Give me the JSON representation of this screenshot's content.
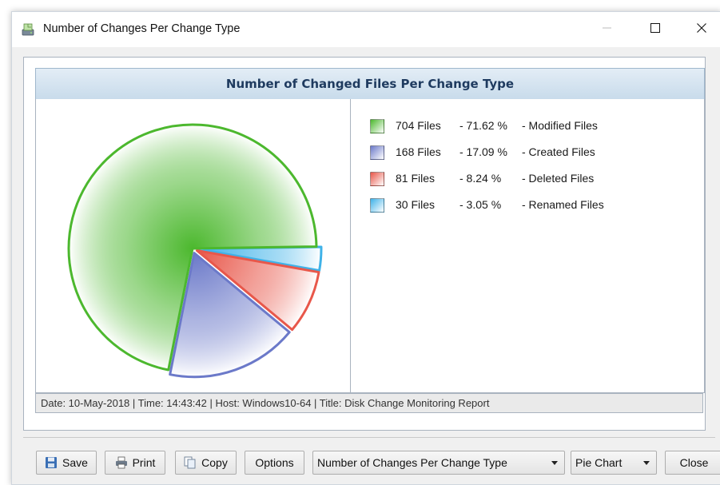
{
  "window": {
    "title": "Number of Changes Per Change Type",
    "icons": {
      "app": "disk-monitor-icon",
      "minimize": "minimize-icon",
      "maximize": "maximize-icon",
      "close": "close-icon"
    }
  },
  "chart_header": "Number of Changed Files Per Change Type",
  "chart_data": {
    "type": "pie",
    "title": "Number of Changed Files Per Change Type",
    "slices": [
      {
        "label": "Modified Files",
        "files": "704 Files",
        "value": 704,
        "percent": "71.62 %",
        "color": "#4cb82e"
      },
      {
        "label": "Created Files",
        "files": "168 Files",
        "value": 168,
        "percent": "17.09 %",
        "color": "#6b79c9"
      },
      {
        "label": "Deleted Files",
        "files": "81 Files",
        "value": 81,
        "percent": "8.24 %",
        "color": "#e8574a"
      },
      {
        "label": "Renamed Files",
        "files": "30 Files",
        "value": 30,
        "percent": "3.05 %",
        "color": "#3fb2e8"
      }
    ],
    "legend_placement": "right"
  },
  "statusbar": "Date: 10-May-2018 | Time: 14:43:42 | Host: Windows10-64 | Title: Disk Change Monitoring Report",
  "toolbar": {
    "save_label": "Save",
    "print_label": "Print",
    "copy_label": "Copy",
    "options_label": "Options",
    "chart_select_value": "Number of Changes Per Change Type",
    "chart_type_value": "Pie Chart",
    "close_label": "Close",
    "icons": {
      "save": "save-icon",
      "print": "print-icon",
      "copy": "copy-icon"
    }
  }
}
